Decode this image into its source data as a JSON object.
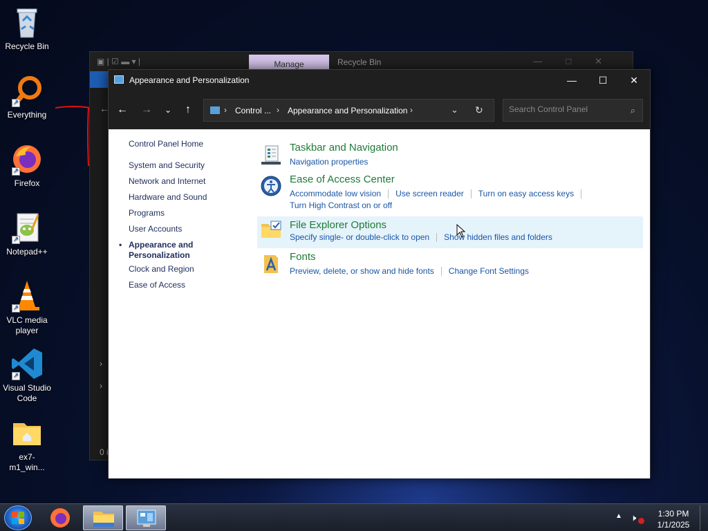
{
  "desktop": {
    "icons": [
      {
        "label": "Recycle Bin"
      },
      {
        "label": "Everything"
      },
      {
        "label": "Firefox"
      },
      {
        "label": "Notepad++"
      },
      {
        "label": "VLC media player"
      },
      {
        "label": "Visual Studio Code"
      },
      {
        "label": "ex7-m1_win..."
      }
    ]
  },
  "back_window": {
    "manage_tab": "Manage",
    "title": "Recycle Bin"
  },
  "window": {
    "title": "Appearance and Personalization",
    "address": {
      "segments": [
        "Control ...",
        "Appearance and Personalization"
      ]
    },
    "search": {
      "placeholder": "Search Control Panel"
    },
    "left_nav": {
      "home": "Control Panel Home",
      "items": [
        "System and Security",
        "Network and Internet",
        "Hardware and Sound",
        "Programs",
        "User Accounts",
        "Appearance and Personalization",
        "Clock and Region",
        "Ease of Access"
      ],
      "current_index": 5
    },
    "sections": [
      {
        "title": "Taskbar and Navigation",
        "icon": "taskbar-icon",
        "links": [
          "Navigation properties"
        ]
      },
      {
        "title": "Ease of Access Center",
        "icon": "ease-of-access-icon",
        "links": [
          "Accommodate low vision",
          "Use screen reader",
          "Turn on easy access keys",
          "Turn High Contrast on or off"
        ]
      },
      {
        "title": "File Explorer Options",
        "icon": "folder-options-icon",
        "links": [
          "Specify single- or double-click to open",
          "Show hidden files and folders"
        ]
      },
      {
        "title": "Fonts",
        "icon": "fonts-icon",
        "links": [
          "Preview, delete, or show and hide fonts",
          "Change Font Settings"
        ]
      }
    ]
  },
  "taskbar": {
    "time": "1:30 PM",
    "date": "1/1/2025"
  }
}
